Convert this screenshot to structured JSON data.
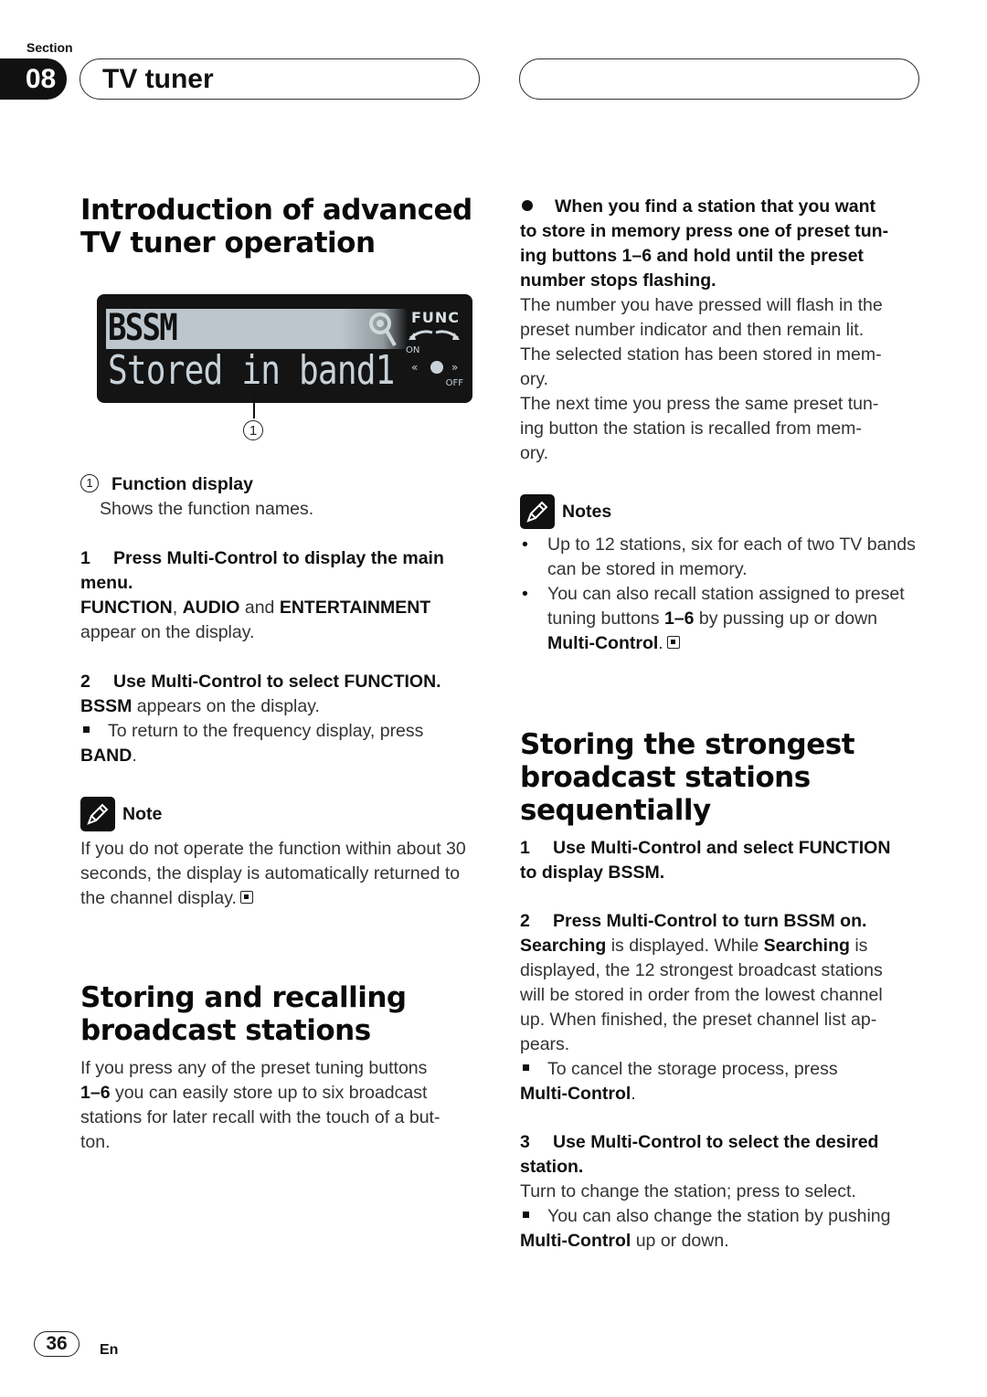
{
  "header": {
    "section_label": "Section",
    "section_number": "08",
    "chapter_title": "TV tuner"
  },
  "left": {
    "intro": {
      "heading_line1": "Introduction of advanced",
      "heading_line2": "TV tuner operation",
      "display": {
        "top_text": "BSSM",
        "bottom_text": "Stored in band1",
        "func_label": "FUNC",
        "on_label": "ON",
        "off_label": "OFF",
        "callout": "1"
      },
      "legend": {
        "number": "1",
        "title": "Function display",
        "desc": "Shows the function names."
      },
      "step1": {
        "num": "1",
        "title_a": "Press Multi-Control to display the main",
        "title_b": "menu.",
        "b1": "FUNCTION",
        "sep1": ", ",
        "b2": "AUDIO",
        "sep2": " and ",
        "b3": "ENTERTAINMENT",
        "tail": "appear on the display."
      },
      "step2": {
        "num": "2",
        "title": "Use Multi-Control to select FUNCTION.",
        "b1": "BSSM",
        "text1": " appears on the display.",
        "bullet_text": "To return to the frequency display, press",
        "bullet_bold": "BAND",
        "bullet_end": "."
      },
      "note": {
        "label": "Note",
        "line1": "If you do not operate the function within about 30",
        "line2": "seconds, the display is automatically returned to",
        "line3": "the channel display."
      }
    },
    "storing": {
      "heading_line1": "Storing and recalling",
      "heading_line2": "broadcast stations",
      "line1": "If you press any of the preset tuning buttons",
      "bold": "1–6",
      "line2": " you can easily store up to six broadcast",
      "line3": "stations for later recall with the touch of a but-",
      "line4": "ton."
    }
  },
  "right": {
    "bullet_step": {
      "line1": "When you find a station that you want",
      "line2": "to store in memory press one of preset tun-",
      "line3": "ing buttons 1–6 and hold until the preset",
      "line4": "number stops flashing.",
      "body": [
        "The number you have pressed will flash in the",
        "preset number indicator and then remain lit.",
        "The selected station has been stored in mem-",
        "ory.",
        "The next time you press the same preset tun-",
        "ing button the station is recalled from mem-",
        "ory."
      ]
    },
    "notes": {
      "label": "Notes",
      "item1_line1": "Up to 12 stations, six for each of two TV bands",
      "item1_line2": "can be stored in memory.",
      "item2_line1": "You can also recall station assigned to preset",
      "item2_pre": "tuning buttons ",
      "item2_bold": "1–6",
      "item2_post": " by pussing up or down",
      "item2_bold2": "Multi-Control",
      "item2_end": "."
    },
    "strongest": {
      "heading_line1": "Storing the strongest",
      "heading_line2": "broadcast stations",
      "heading_line3": "sequentially",
      "step1": {
        "num": "1",
        "line1": "Use Multi-Control and select FUNCTION",
        "line2": "to display BSSM."
      },
      "step2": {
        "num": "2",
        "title": "Press Multi-Control to turn BSSM on.",
        "b1": "Searching",
        "t1": " is displayed. While ",
        "b2": "Searching",
        "t2": " is",
        "line2": "displayed, the 12 strongest broadcast stations",
        "line3": "will be stored in order from the lowest channel",
        "line4": "up. When finished, the preset channel list ap-",
        "line5": "pears.",
        "bullet_text": "To cancel the storage process, press",
        "bullet_bold": "Multi-Control",
        "bullet_end": "."
      },
      "step3": {
        "num": "3",
        "line1": "Use Multi-Control to select the desired",
        "line2": "station.",
        "body": "Turn to change the station; press to select.",
        "bullet_text": "You can also change the station by pushing",
        "bullet_bold": "Multi-Control",
        "bullet_end": " up or down."
      }
    }
  },
  "footer": {
    "page_number": "36",
    "language": "En"
  }
}
